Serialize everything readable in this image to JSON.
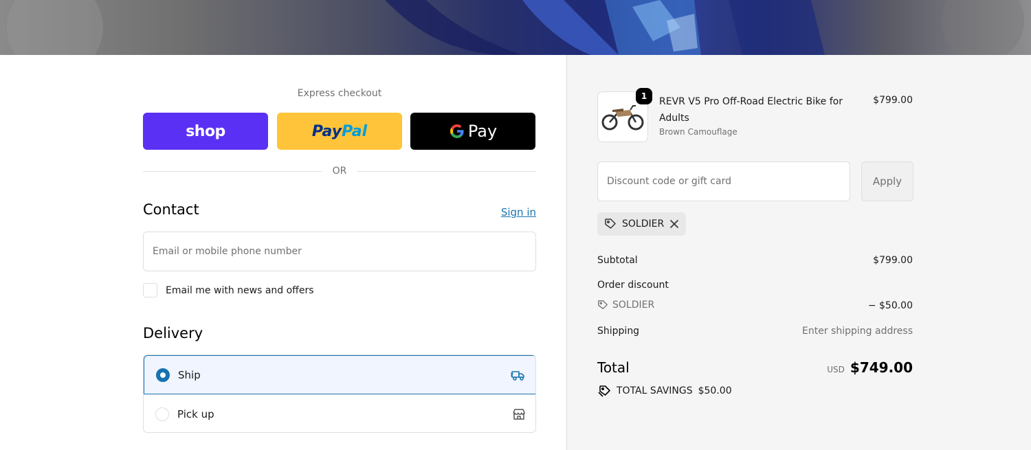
{
  "express": {
    "title": "Express checkout",
    "shop_label": "shop",
    "paypal_label_a": "Pay",
    "paypal_label_b": "Pal",
    "gpay_label": "Pay",
    "or_label": "OR"
  },
  "contact": {
    "title": "Contact",
    "signin_label": "Sign in",
    "email_placeholder": "Email or mobile phone number",
    "newsletter_label": "Email me with news and offers"
  },
  "delivery": {
    "title": "Delivery",
    "options": [
      {
        "label": "Ship",
        "selected": true,
        "icon": "truck-icon"
      },
      {
        "label": "Pick up",
        "selected": false,
        "icon": "store-icon"
      }
    ]
  },
  "order": {
    "product": {
      "name": "REVR V5 Pro Off-Road Electric Bike for Adults",
      "variant": "Brown Camouflage",
      "price": "$799.00",
      "quantity": "1"
    },
    "discount_placeholder": "Discount code or gift card",
    "apply_label": "Apply",
    "applied_code": "SOLDIER",
    "subtotal_label": "Subtotal",
    "subtotal_value": "$799.00",
    "order_discount_label": "Order discount",
    "discount_code": "SOLDIER",
    "discount_value": "− $50.00",
    "shipping_label": "Shipping",
    "shipping_value": "Enter shipping address",
    "total_label": "Total",
    "total_currency": "USD",
    "total_value": "$749.00",
    "savings_label": "TOTAL SAVINGS",
    "savings_value": "$50.00"
  },
  "colors": {
    "accent": "#1773b0",
    "shop_pay": "#5a31f4",
    "paypal": "#ffc439",
    "gpay": "#000000"
  }
}
